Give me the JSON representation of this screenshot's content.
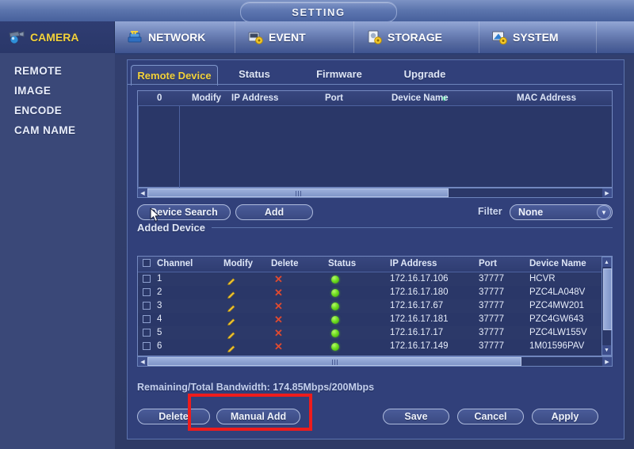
{
  "window": {
    "title": "SETTING"
  },
  "menu": {
    "items": [
      {
        "label": "CAMERA",
        "icon": "camera-icon",
        "active": true
      },
      {
        "label": "NETWORK",
        "icon": "network-icon",
        "active": false
      },
      {
        "label": "EVENT",
        "icon": "event-icon",
        "active": false
      },
      {
        "label": "STORAGE",
        "icon": "storage-icon",
        "active": false
      },
      {
        "label": "SYSTEM",
        "icon": "system-icon",
        "active": false
      }
    ]
  },
  "sidebar": {
    "items": [
      {
        "label": "REMOTE"
      },
      {
        "label": "IMAGE"
      },
      {
        "label": "ENCODE"
      },
      {
        "label": "CAM NAME"
      }
    ]
  },
  "tabs": [
    {
      "label": "Remote Device",
      "active": true
    },
    {
      "label": "Status",
      "active": false
    },
    {
      "label": "Firmware",
      "active": false
    },
    {
      "label": "Upgrade",
      "active": false
    }
  ],
  "search_table": {
    "headers": [
      "0",
      "Modify",
      "IP Address",
      "Port",
      "Device Name",
      "MAC Address"
    ],
    "sort_column": "IP Address",
    "sort_icon": "chevron-down-icon",
    "rows": []
  },
  "toolbar": {
    "device_search_label": "Device Search",
    "add_label": "Add",
    "filter_label": "Filter",
    "filter_value": "None"
  },
  "added_device": {
    "section_label": "Added Device",
    "headers": [
      "Channel",
      "Modify",
      "Delete",
      "Status",
      "IP Address",
      "Port",
      "Device Name"
    ],
    "rows": [
      {
        "channel": "1",
        "modify": "pencil-icon",
        "delete": "x-icon",
        "status": "online",
        "ip": "172.16.17.106",
        "port": "37777",
        "device_name": "HCVR"
      },
      {
        "channel": "2",
        "modify": "pencil-icon",
        "delete": "x-icon",
        "status": "online",
        "ip": "172.16.17.180",
        "port": "37777",
        "device_name": "PZC4LA048V"
      },
      {
        "channel": "3",
        "modify": "pencil-icon",
        "delete": "x-icon",
        "status": "online",
        "ip": "172.16.17.67",
        "port": "37777",
        "device_name": "PZC4MW201"
      },
      {
        "channel": "4",
        "modify": "pencil-icon",
        "delete": "x-icon",
        "status": "online",
        "ip": "172.16.17.181",
        "port": "37777",
        "device_name": "PZC4GW643"
      },
      {
        "channel": "5",
        "modify": "pencil-icon",
        "delete": "x-icon",
        "status": "online",
        "ip": "172.16.17.17",
        "port": "37777",
        "device_name": "PZC4LW155V"
      },
      {
        "channel": "6",
        "modify": "pencil-icon",
        "delete": "x-icon",
        "status": "online",
        "ip": "172.16.17.149",
        "port": "37777",
        "device_name": "1M01596PAV"
      }
    ]
  },
  "bandwidth": {
    "text": "Remaining/Total Bandwidth: 174.85Mbps/200Mbps"
  },
  "footer": {
    "delete_label": "Delete",
    "manual_add_label": "Manual Add",
    "save_label": "Save",
    "cancel_label": "Cancel",
    "apply_label": "Apply"
  },
  "annotation": {
    "color": "#ee1c1c",
    "highlights": [
      "Manual Add"
    ]
  },
  "colors": {
    "accent_yellow": "#f3d23b",
    "status_online": "#6ede1f",
    "delete_red": "#e04a2f",
    "panel_blue": "#31407a",
    "annotation_red": "#ee1c1c"
  }
}
